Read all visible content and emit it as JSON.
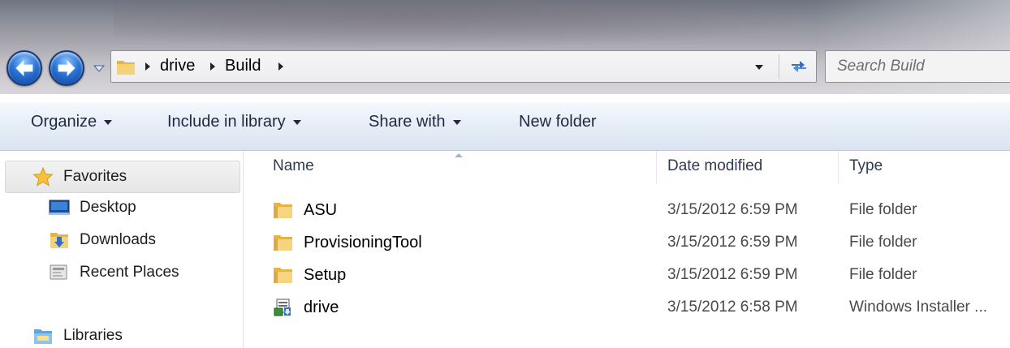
{
  "address_bar": {
    "crumbs": [
      "drive",
      "Build"
    ]
  },
  "search": {
    "placeholder": "Search Build"
  },
  "toolbar": {
    "organize": "Organize",
    "include_in_library": "Include in library",
    "share_with": "Share with",
    "new_folder": "New folder"
  },
  "nav_pane": {
    "favorites": "Favorites",
    "items": [
      "Desktop",
      "Downloads",
      "Recent Places"
    ],
    "libraries": "Libraries"
  },
  "columns": {
    "name": "Name",
    "date_modified": "Date modified",
    "type": "Type"
  },
  "files": [
    {
      "name": "ASU",
      "date": "3/15/2012 6:59 PM",
      "type": "File folder",
      "icon": "folder-icon"
    },
    {
      "name": "ProvisioningTool",
      "date": "3/15/2012 6:59 PM",
      "type": "File folder",
      "icon": "folder-icon"
    },
    {
      "name": "Setup",
      "date": "3/15/2012 6:59 PM",
      "type": "File folder",
      "icon": "folder-icon"
    },
    {
      "name": "drive",
      "date": "3/15/2012 6:58 PM",
      "type": "Windows Installer ...",
      "icon": "installer-icon"
    }
  ],
  "colors": {
    "toolbar_bg": "#dae4f1",
    "nav_button": "#2a74d6",
    "folder": "#e8b84a"
  }
}
